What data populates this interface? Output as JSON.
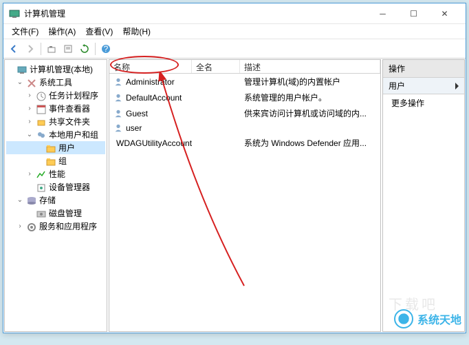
{
  "window": {
    "title": "计算机管理"
  },
  "menubar": {
    "items": [
      "文件(F)",
      "操作(A)",
      "查看(V)",
      "帮助(H)"
    ]
  },
  "toolbar": {
    "back": "back",
    "forward": "forward",
    "up": "up",
    "show": "show",
    "refresh": "refresh",
    "export": "export",
    "help": "help"
  },
  "tree": [
    {
      "label": "计算机管理(本地)",
      "lvl": 1,
      "exp": "",
      "icon": "computer"
    },
    {
      "label": "系统工具",
      "lvl": 2,
      "exp": "v",
      "icon": "tools"
    },
    {
      "label": "任务计划程序",
      "lvl": 3,
      "exp": ">",
      "icon": "task"
    },
    {
      "label": "事件查看器",
      "lvl": 3,
      "exp": ">",
      "icon": "event"
    },
    {
      "label": "共享文件夹",
      "lvl": 3,
      "exp": ">",
      "icon": "share"
    },
    {
      "label": "本地用户和组",
      "lvl": 3,
      "exp": "v",
      "icon": "users"
    },
    {
      "label": "用户",
      "lvl": 4,
      "exp": "",
      "icon": "folder",
      "selected": true
    },
    {
      "label": "组",
      "lvl": 4,
      "exp": "",
      "icon": "folder"
    },
    {
      "label": "性能",
      "lvl": 3,
      "exp": ">",
      "icon": "perf"
    },
    {
      "label": "设备管理器",
      "lvl": 3,
      "exp": "",
      "icon": "device"
    },
    {
      "label": "存储",
      "lvl": 2,
      "exp": "v",
      "icon": "storage"
    },
    {
      "label": "磁盘管理",
      "lvl": 3,
      "exp": "",
      "icon": "disk"
    },
    {
      "label": "服务和应用程序",
      "lvl": 2,
      "exp": ">",
      "icon": "svc"
    }
  ],
  "columns": {
    "name": "名称",
    "fullname": "全名",
    "desc": "描述"
  },
  "users": [
    {
      "name": "Administrator",
      "fullname": "",
      "desc": "管理计算机(域)的内置帐户"
    },
    {
      "name": "DefaultAccount",
      "fullname": "",
      "desc": "系统管理的用户帐户。"
    },
    {
      "name": "Guest",
      "fullname": "",
      "desc": "供来宾访问计算机或访问域的内..."
    },
    {
      "name": "user",
      "fullname": "",
      "desc": ""
    },
    {
      "name": "WDAGUtilityAccount",
      "fullname": "",
      "desc": "系统为 Windows Defender 应用..."
    }
  ],
  "actions": {
    "header": "操作",
    "sub": "用户",
    "more": "更多操作"
  },
  "watermark": {
    "text": "系统天地",
    "faint": "下载吧"
  }
}
